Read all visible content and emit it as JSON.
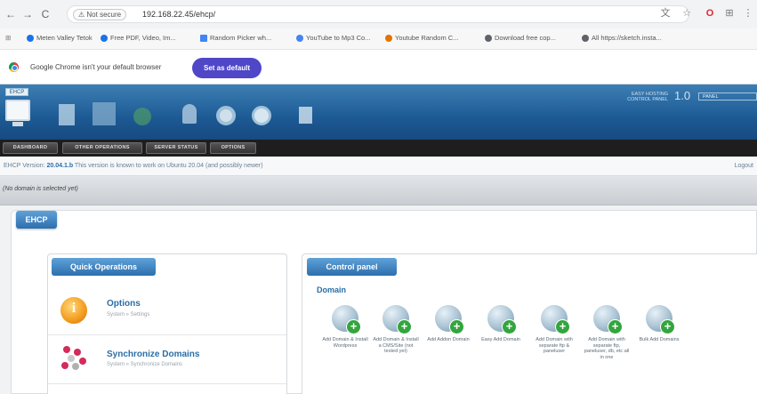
{
  "browser": {
    "nav": {
      "back": "←",
      "forward": "→",
      "reload": "C"
    },
    "security_badge": "⚠ Not secure",
    "url": "192.168.22.45/ehcp/",
    "extensions": [
      "translate-icon",
      "star-icon",
      "opera-icon",
      "extension-icon",
      "menu-icon"
    ],
    "bookmarks": [
      {
        "label": "Meten Valley Tetok",
        "color": "#1a73e8"
      },
      {
        "label": "Free PDF, Video, Im...",
        "color": "#1a73e8"
      },
      {
        "label": "Random Picker wh...",
        "color": "#4285f4"
      },
      {
        "label": "YouTube to Mp3 Co...",
        "color": "#4285f4"
      },
      {
        "label": "Youtube Random C...",
        "color": "#e37400"
      },
      {
        "label": "Download free cop...",
        "color": "#5f6368"
      },
      {
        "label": "All https://sketch.insta...",
        "color": "#5f6368"
      }
    ]
  },
  "infobar": {
    "message": "Google Chrome isn't your default browser",
    "button": "Set as default"
  },
  "header": {
    "version_badge": "EHCP",
    "right_text_1": "EASY HOSTING",
    "right_text_2": "CONTROL PANEL",
    "version_number": "1.0",
    "right_badge": "PANEL"
  },
  "menu": {
    "tabs": [
      "DASHBOARD",
      "OTHER OPERATIONS",
      "SERVER STATUS",
      "OPTIONS"
    ]
  },
  "version_bar": {
    "prefix": "EHCP Version:",
    "version": "20.04.1.b",
    "text": "This version is known to work on Ubuntu 20.04 (and possibly newer)",
    "logout": "Logout"
  },
  "domain_bar": {
    "text": "(No domain is selected yet)"
  },
  "panel": {
    "tab": "EHCP"
  },
  "quick_operations": {
    "title": "Quick Operations",
    "items": [
      {
        "title": "Options",
        "subtitle": "System » Settings"
      },
      {
        "title": "Synchronize Domains",
        "subtitle": "System » Synchronize Domains"
      }
    ]
  },
  "control_panel": {
    "title": "Control panel",
    "section": "Domain",
    "items": [
      {
        "label": "Add Domain & Install Wordpress"
      },
      {
        "label": "Add Domain & Install a CMS/Site (not tested yet)"
      },
      {
        "label": "Add Addon Domain"
      },
      {
        "label": "Easy Add Domain"
      },
      {
        "label": "Add Domain with separate ftp & paneluser"
      },
      {
        "label": "Add Domain with separate ftp, paneluser, db, etc all in one"
      },
      {
        "label": "Bulk Add Domains"
      }
    ]
  }
}
